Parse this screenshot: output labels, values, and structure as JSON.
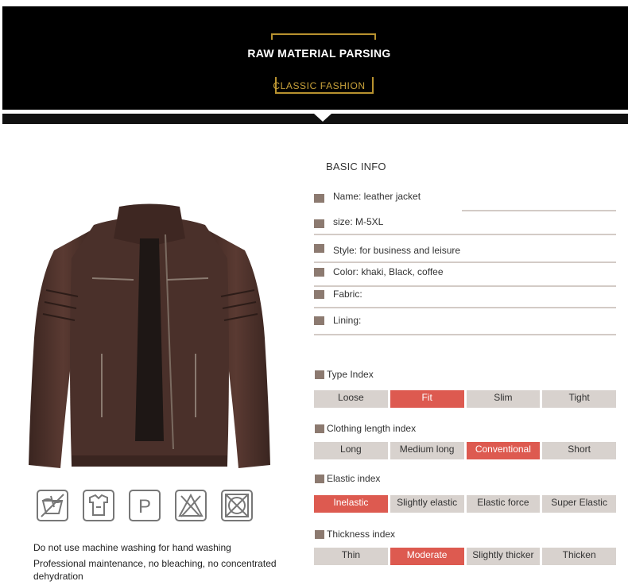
{
  "banner": {
    "title": "RAW MATERIAL PARSING",
    "subtitle": "CLASSIC FASHION"
  },
  "basic_info": {
    "title": "BASIC INFO",
    "rows": [
      "Name: leather jacket",
      "size: M-5XL",
      "Style: for business and leisure",
      "Color: khaki, Black, coffee",
      "Fabric:",
      "Lining:"
    ]
  },
  "indexes": [
    {
      "title": "Type Index",
      "options": [
        "Loose",
        "Fit",
        "Slim",
        "Tight"
      ],
      "selected": "Fit"
    },
    {
      "title": "Clothing length index",
      "options": [
        "Long",
        "Medium long",
        "Conventional",
        "Short"
      ],
      "selected": "Conventional"
    },
    {
      "title": "Elastic index",
      "options": [
        "Inelastic",
        "Slightly elastic",
        "Elastic force",
        "Super Elastic"
      ],
      "selected": "Inelastic"
    },
    {
      "title": "Thickness index",
      "options": [
        "Thin",
        "Moderate",
        "Slightly thicker",
        "Thicken"
      ],
      "selected": "Moderate"
    }
  ],
  "care": {
    "icons": [
      "hand-wash-icon",
      "professional-clean-icon",
      "dry-clean-p-icon",
      "no-bleach-icon",
      "no-tumble-dry-icon"
    ],
    "line1": "Do not use machine washing for hand washing",
    "line2": "Professional maintenance, no bleaching, no concentrated dehydration"
  },
  "colors": {
    "banner_bg": "#000000",
    "gold": "#c9a23b",
    "active": "#dd5a50",
    "inactive": "#d8d2ce",
    "bullet": "#8c7a70",
    "jacket": "#4a302a"
  }
}
